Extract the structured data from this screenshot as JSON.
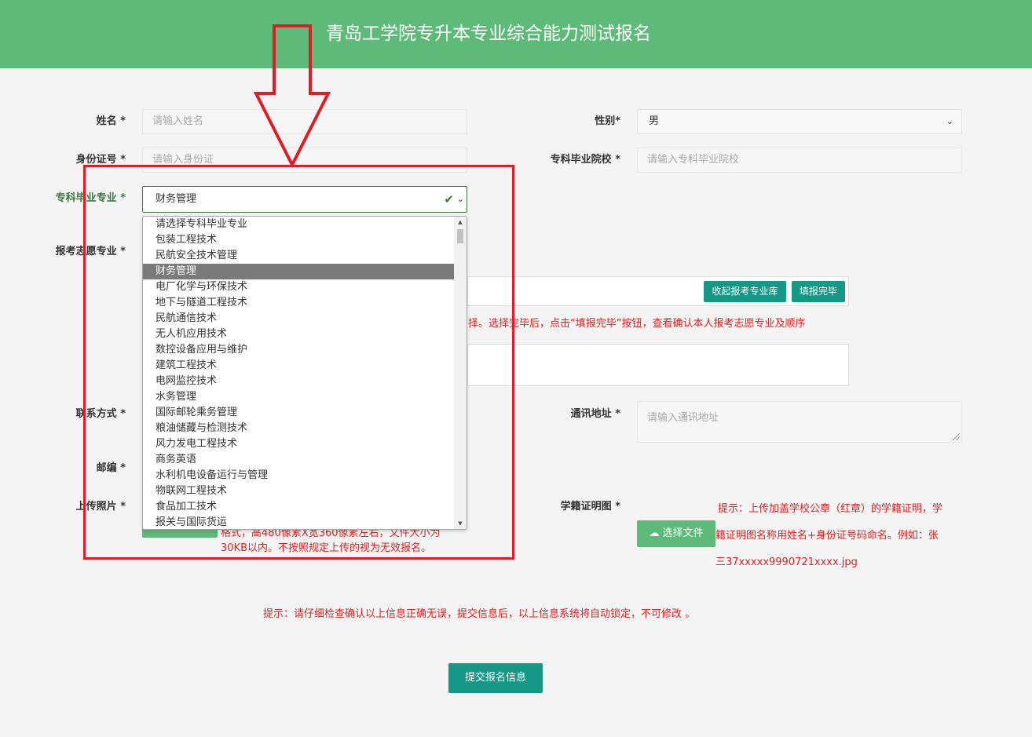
{
  "header": {
    "title": "青岛工学院专升本专业综合能力测试报名",
    "bg": "#5dba79"
  },
  "form": {
    "name": {
      "label": "姓名 *",
      "placeholder": "请输入姓名"
    },
    "gender": {
      "label": "性别*",
      "value": "男"
    },
    "idcard": {
      "label": "身份证号 *",
      "placeholder": "请输入身份证"
    },
    "college": {
      "label": "专科毕业院校 *",
      "placeholder": "请输入专科毕业院校"
    },
    "major": {
      "label": "专科毕业专业 *",
      "value": "财务管理"
    },
    "apply": {
      "label": "报考志愿专业 *",
      "collapse_button": "收起报考专业库",
      "done_button": "填报完毕",
      "hint": "择。选择完毕后，点击“填报完毕”按钮，查看确认本人报考志愿专业及顺序"
    },
    "contact": {
      "label": "联系方式 *"
    },
    "address": {
      "label": "通讯地址 *",
      "placeholder": "请输入通讯地址"
    },
    "zipcode": {
      "label": "邮编 *"
    },
    "photo": {
      "label": "上传照片 *",
      "hint_line1": "格式，高480像素X宽360像素左右，文件大小为",
      "hint_line2": "30KB以内。不按照规定上传的视为无效报名。"
    },
    "cert": {
      "label": "学籍证明图 *",
      "button": "选择文件",
      "hint_line1": "提示：上传加盖学校公章（红章）的学籍证明，学",
      "hint_line2": "籍证明图名称用姓名+身份证号码命名。例如：张",
      "hint_line3": "三37xxxxx9990721xxxx.jpg"
    },
    "notice": "提示：请仔细检查确认以上信息正确无误，提交信息后，以上信息系统将自动锁定，不可修改 。",
    "submit": "提交报名信息"
  },
  "dropdown": {
    "selected_index": 3,
    "options": [
      "请选择专科毕业专业",
      "包装工程技术",
      "民航安全技术管理",
      "财务管理",
      "电厂化学与环保技术",
      "地下与隧道工程技术",
      "民航通信技术",
      "无人机应用技术",
      "数控设备应用与维护",
      "建筑工程技术",
      "电网监控技术",
      "水务管理",
      "国际邮轮乘务管理",
      "粮油储藏与检测技术",
      "风力发电工程技术",
      "商务英语",
      "水利机电设备运行与管理",
      "物联网工程技术",
      "食品加工技术",
      "报关与国际货运"
    ]
  },
  "colors": {
    "accent": "#5dba79",
    "button": "#159886",
    "warning": "#e02020",
    "annotation": "#e21c24"
  }
}
